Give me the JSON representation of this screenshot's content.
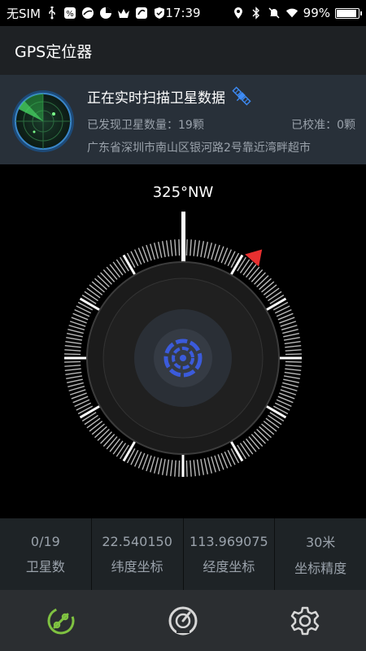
{
  "status_bar": {
    "carrier": "无SIM",
    "time": "17:39",
    "battery": "99%",
    "battery_level": 0.99
  },
  "app_bar": {
    "title": "GPS定位器"
  },
  "scan_card": {
    "title": "正在实时扫描卫星数据",
    "found_label": "已发现卫星数量：19颗",
    "calibrated_label": "已校准：0颗",
    "address": "广东省深圳市南山区银河路2号靠近湾畔超市"
  },
  "compass": {
    "heading": "325°NW",
    "heading_degrees": 325
  },
  "stats": [
    {
      "value": "0/19",
      "label": "卫星数"
    },
    {
      "value": "22.540150",
      "label": "纬度坐标"
    },
    {
      "value": "113.969075",
      "label": "经度坐标"
    },
    {
      "value": "30米",
      "label": "坐标精度"
    }
  ],
  "nav": [
    {
      "icon": "location-link-icon",
      "active": true,
      "color": "#7fc241"
    },
    {
      "icon": "speedometer-icon",
      "active": false,
      "color": "#d6d6d6"
    },
    {
      "icon": "gear-icon",
      "active": false,
      "color": "#d6d6d6"
    }
  ],
  "colors": {
    "accent_green": "#7fc241",
    "marker_red": "#e83030",
    "compass_blue": "#3b5bdb",
    "satellite_blue": "#3d8bf5"
  }
}
